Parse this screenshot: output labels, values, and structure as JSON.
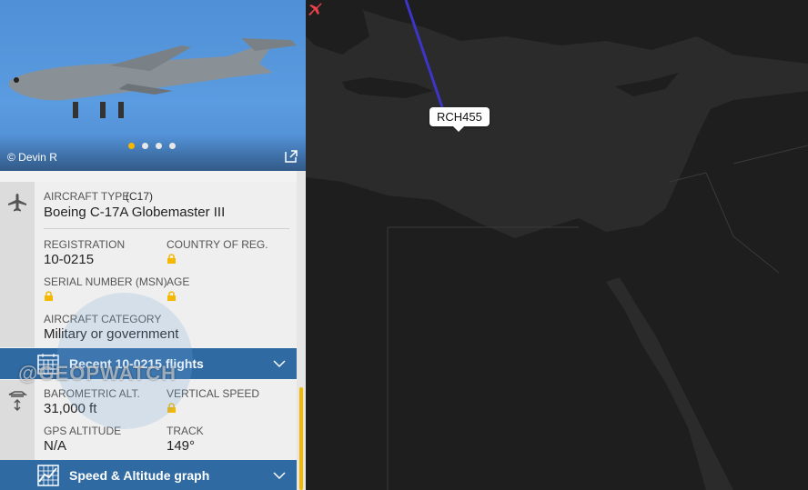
{
  "photo": {
    "credit": "© Devin R",
    "dots": 4,
    "active_dot": 0
  },
  "map": {
    "callsign": "RCH455"
  },
  "aircraft": {
    "type_label": "AIRCRAFT TYPE",
    "type_code": "(C17)",
    "type_value": "Boeing C-17A Globemaster III",
    "registration_label": "REGISTRATION",
    "registration_value": "10-0215",
    "country_label": "COUNTRY OF REG.",
    "serial_label": "SERIAL NUMBER (MSN)",
    "age_label": "AGE",
    "category_label": "AIRCRAFT CATEGORY",
    "category_value": "Military or government"
  },
  "recent_flights": {
    "label": "Recent 10-0215 flights"
  },
  "altitude": {
    "baro_label": "BAROMETRIC ALT.",
    "baro_value": "31,000 ft",
    "vs_label": "VERTICAL SPEED",
    "gps_label": "GPS ALTITUDE",
    "gps_value": "N/A",
    "track_label": "TRACK",
    "track_value": "149°"
  },
  "graph_bar": {
    "label": "Speed & Altitude graph"
  },
  "watermark": "@GEOPWATCH",
  "colors": {
    "accent": "#f5b800",
    "bar": "#2f6aa3",
    "track_line": "#3d35c9",
    "plane": "#e8424a"
  }
}
